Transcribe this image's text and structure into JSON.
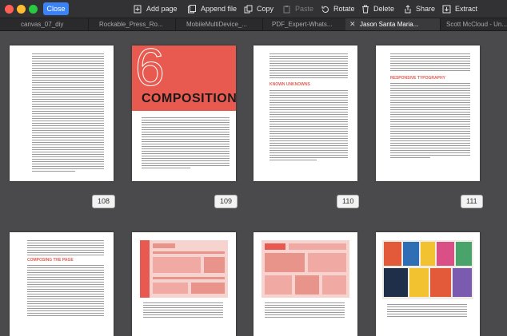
{
  "toolbar": {
    "close_label": "Close",
    "buttons": {
      "add_page": "Add page",
      "append_file": "Append file",
      "copy": "Copy",
      "paste": "Paste",
      "rotate": "Rotate",
      "delete": "Delete",
      "share": "Share",
      "extract": "Extract"
    }
  },
  "tabs": [
    {
      "label": "canvas_07_diy"
    },
    {
      "label": "Rockable_Press_Ro..."
    },
    {
      "label": "MobileMultiDevice_..."
    },
    {
      "label": "PDF_Expert-Whats..."
    },
    {
      "label": "Jason Santa Maria..."
    },
    {
      "label": "Scott McCloud - Un..."
    }
  ],
  "pages": {
    "p108": {
      "number": "108"
    },
    "p109": {
      "number": "109",
      "chapter_number": "6",
      "title": "COMPOSITION"
    },
    "p110": {
      "number": "110",
      "heading": "KNOWN UNKNOWNS"
    },
    "p111": {
      "number": "111",
      "heading": "RESPONSIVE TYPOGRAPHY"
    },
    "p112": {
      "heading": "COMPOSING THE PAGE"
    }
  },
  "colors": {
    "accent": "#3b82f6",
    "chapter_red": "#e85a4f",
    "toolbar_bg": "#323234",
    "grid_bg": "#4a4a4c"
  }
}
